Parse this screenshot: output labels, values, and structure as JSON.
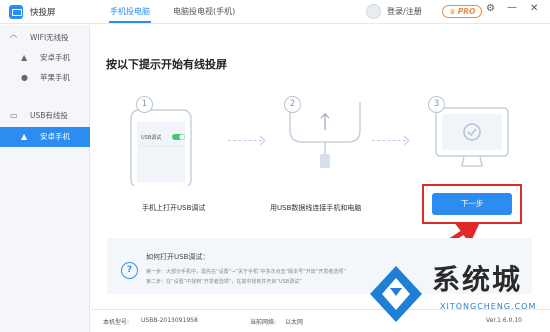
{
  "app": {
    "name": "快投屏"
  },
  "tabs": [
    {
      "label": "手机投电脑",
      "active": true
    },
    {
      "label": "电脑投电视(手机)",
      "active": false
    }
  ],
  "account": {
    "login_label": "登录/注册",
    "badge": "PRO"
  },
  "sidebar": {
    "groups": [
      {
        "label": "WIFI无线投",
        "icon": "wifi-icon",
        "items": [
          {
            "label": "安卓手机",
            "icon": "android-icon"
          },
          {
            "label": "苹果手机",
            "icon": "apple-icon"
          }
        ]
      },
      {
        "label": "USB有线投",
        "icon": "usb-icon",
        "items": [
          {
            "label": "安卓手机",
            "icon": "android-icon",
            "selected": true
          }
        ]
      }
    ]
  },
  "main": {
    "title": "按以下提示开始有线投屏",
    "steps": [
      {
        "number": "1",
        "caption": "手机上打开USB调试",
        "toggle_label": "USB调试"
      },
      {
        "number": "2",
        "caption": "用USB数据线连接手机和电脑"
      },
      {
        "number": "3",
        "caption": ""
      }
    ],
    "next_button": "下一步"
  },
  "help": {
    "title": "如何打开USB调试：",
    "lines": [
      "第一步：大部分手机中，需先在“设置”→“关于手机”中多次点击“版本号”开启“开发者选项”",
      "第二步：在“设置”中找到“开发者选项”，在其中找到并开启“USB调试”"
    ]
  },
  "status": {
    "model_label": "本机型号:",
    "model_value": "USBB-2013091958",
    "network_label": "当前网络:",
    "network_value": "以太网",
    "version": "Ver.1.6.0.10"
  },
  "watermark": {
    "text": "系统城",
    "url": "XITONGCHENG.COM"
  },
  "colors": {
    "accent": "#2c8cf0",
    "highlight_box": "#e02a2a",
    "pro": "#f08c3d"
  }
}
